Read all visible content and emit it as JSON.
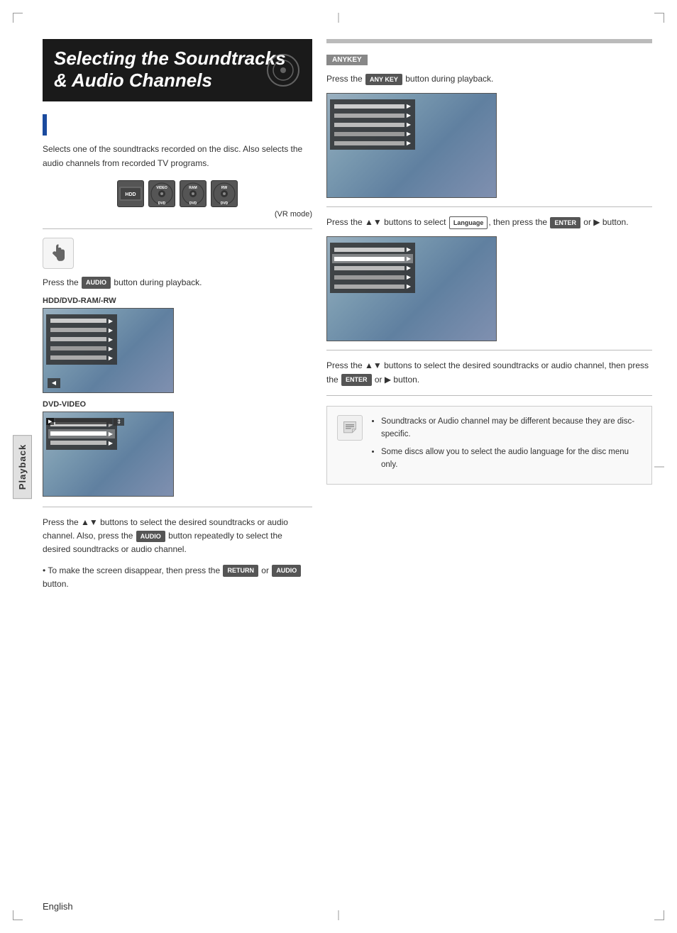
{
  "page": {
    "title": "Selecting the Soundtracks & Audio Channels",
    "footer_language": "English"
  },
  "title": {
    "line1": "Selecting the Soundtracks",
    "line2": "& Audio Channels"
  },
  "description": {
    "text": "Selects one of the soundtracks recorded on the disc. Also selects the audio channels from recorded TV programs."
  },
  "vr_mode": "(VR mode)",
  "anykey_badge": "ANYKEY",
  "left_section": {
    "step1_prefix": "Press the",
    "step1_suffix": "button during playback.",
    "hdd_label": "HDD/DVD-RAM/-RW",
    "dvd_label": "DVD-VIDEO",
    "step2": {
      "text": "Press the ▲▼ buttons to select the desired soundtracks or audio channel. Also, press the",
      "text2": "button repeatedly to select the desired soundtracks or audio channel.",
      "bullet": "• To make the screen disappear, then press the",
      "bullet_suffix": "or",
      "bullet_suffix2": "button."
    }
  },
  "right_section": {
    "step1_prefix": "Press the",
    "step1_suffix": "button during playback.",
    "step2": {
      "prefix": "Press the ▲▼ buttons to select",
      "suffix": ", then press the",
      "suffix2": "or ▶ button."
    },
    "step3": {
      "text": "Press the ▲▼ buttons to select the desired soundtracks or audio channel, then press the",
      "suffix": "or ▶ button."
    }
  },
  "note": {
    "items": [
      "Soundtracks or Audio channel may be different because they are disc-specific.",
      "Some discs allow you to select the audio language for the disc menu only."
    ]
  },
  "devices": [
    {
      "label": "HDD"
    },
    {
      "label": "DVD\nVIDEO"
    },
    {
      "label": "DVD\nRAM"
    },
    {
      "label": "DVD\nRW"
    }
  ],
  "sidebar_label": "Playback"
}
